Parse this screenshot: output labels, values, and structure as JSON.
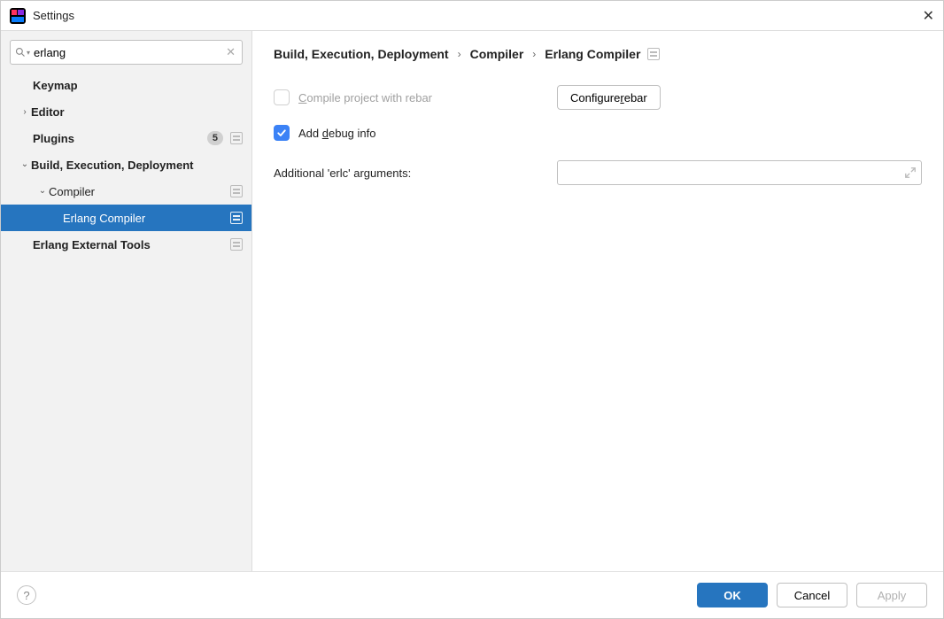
{
  "window": {
    "title": "Settings"
  },
  "search": {
    "value": "erlang"
  },
  "sidebar": {
    "items": [
      {
        "label": "Keymap"
      },
      {
        "label": "Editor"
      },
      {
        "label": "Plugins",
        "badge": "5"
      },
      {
        "label": "Build, Execution, Deployment"
      },
      {
        "label": "Compiler"
      },
      {
        "label": "Erlang Compiler"
      },
      {
        "label": "Erlang External Tools"
      }
    ]
  },
  "breadcrumb": {
    "part1": "Build, Execution, Deployment",
    "part2": "Compiler",
    "part3": "Erlang Compiler"
  },
  "form": {
    "compile_rebar_pre": "C",
    "compile_rebar_post": "ompile project with rebar",
    "configure_rebar_pre": "Configure ",
    "configure_rebar_mn": "r",
    "configure_rebar_post": "ebar",
    "debug_pre": "Add ",
    "debug_mn": "d",
    "debug_post": "ebug info",
    "args_label": "Additional 'erlc' arguments:",
    "args_value": ""
  },
  "footer": {
    "ok": "OK",
    "cancel": "Cancel",
    "apply": "Apply"
  }
}
